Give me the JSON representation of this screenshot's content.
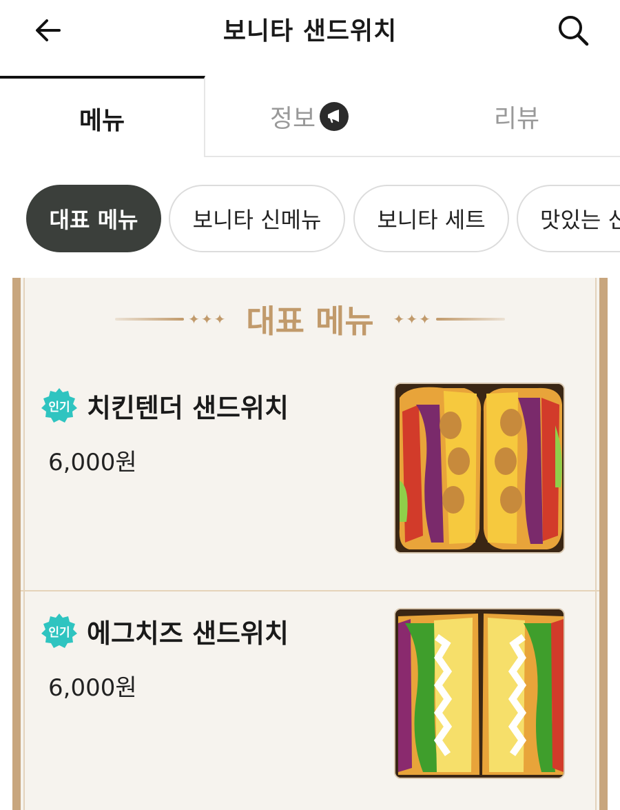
{
  "header": {
    "title": "보니타 샌드위치",
    "back_icon": "arrow-left-icon",
    "search_icon": "search-icon"
  },
  "tabs": [
    {
      "label": "메뉴",
      "active": true
    },
    {
      "label": "정보",
      "active": false,
      "icon": "megaphone-icon"
    },
    {
      "label": "리뷰",
      "active": false
    }
  ],
  "categories": [
    {
      "label": "대표 메뉴",
      "active": true
    },
    {
      "label": "보니타 신메뉴",
      "active": false
    },
    {
      "label": "보니타 세트",
      "active": false
    },
    {
      "label": "맛있는 신",
      "active": false
    }
  ],
  "section": {
    "title": "대표 메뉴"
  },
  "items": [
    {
      "badge": "인기",
      "name": "치킨텐더 샌드위치",
      "price": "6,000원",
      "photo": "chicken-tender-sandwich-photo"
    },
    {
      "badge": "인기",
      "name": "에그치즈 샌드위치",
      "price": "6,000원",
      "photo": "egg-cheese-sandwich-photo"
    }
  ],
  "colors": {
    "accent_gold": "#c19a6b",
    "badge_teal": "#2fc4c0",
    "chip_active": "#3b3f3b",
    "panel_bg": "#f6f3ee"
  }
}
